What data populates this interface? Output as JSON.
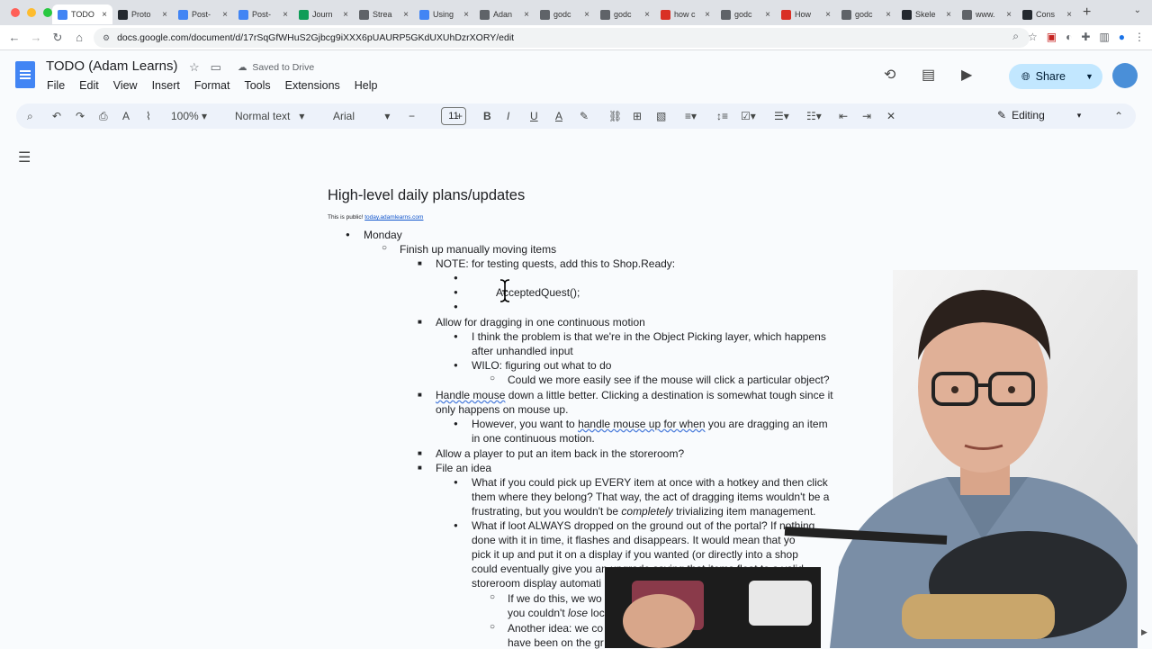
{
  "browser": {
    "tabs": [
      {
        "label": "TODO",
        "color": "#4285f4",
        "active": true
      },
      {
        "label": "Proto",
        "color": "#24292f"
      },
      {
        "label": "Post-",
        "color": "#4285f4"
      },
      {
        "label": "Post-",
        "color": "#4285f4"
      },
      {
        "label": "Journ",
        "color": "#0f9d58"
      },
      {
        "label": "Strea",
        "color": "#5f6368"
      },
      {
        "label": "Using",
        "color": "#4285f4"
      },
      {
        "label": "Adan",
        "color": "#5f6368"
      },
      {
        "label": "godc",
        "color": "#5f6368"
      },
      {
        "label": "godc",
        "color": "#5f6368"
      },
      {
        "label": "how c",
        "color": "#d93025"
      },
      {
        "label": "godc",
        "color": "#5f6368"
      },
      {
        "label": "How",
        "color": "#d93025"
      },
      {
        "label": "godc",
        "color": "#5f6368"
      },
      {
        "label": "Skele",
        "color": "#24292f"
      },
      {
        "label": "www.",
        "color": "#5f6368"
      },
      {
        "label": "Cons",
        "color": "#24292f"
      }
    ],
    "tab_close": "×",
    "new_tab": "+",
    "url": "docs.google.com/document/d/17rSqGfWHuS2Gjbcg9iXXX6pUAURP5GKdUXUhDzrXORY/edit"
  },
  "doc": {
    "title": "TODO (Adam Learns)",
    "saved_status": "Saved to Drive",
    "menus": [
      "File",
      "Edit",
      "View",
      "Insert",
      "Format",
      "Tools",
      "Extensions",
      "Help"
    ],
    "share_label": "Share",
    "toolbar": {
      "zoom": "100%",
      "style": "Normal text",
      "font": "Arial",
      "font_size": "11",
      "mode": "Editing"
    }
  },
  "content": {
    "heading": "High-level daily plans/updates",
    "public_note": "This is public!",
    "public_link": "today.adamlearns.com",
    "lines": [
      {
        "bullet": "●",
        "text": "Monday"
      },
      {
        "bullet": "○",
        "text": "Finish up manually moving items"
      },
      {
        "bullet": "■",
        "text": "NOTE: for testing quests, add this to Shop.Ready:"
      },
      {
        "bullet": "●",
        "text": ""
      },
      {
        "bullet": "●",
        "text": "AcceptedQuest();"
      },
      {
        "bullet": "●",
        "text": ""
      },
      {
        "bullet": "■",
        "text": "Allow for dragging in one continuous motion"
      },
      {
        "bullet": "●",
        "text": "I think the problem is that we're in the Object Picking layer, which happens"
      },
      {
        "bullet": "",
        "text": "after unhandled input"
      },
      {
        "bullet": "●",
        "text": "WILO: figuring out what to do"
      },
      {
        "bullet": "○",
        "text": "Could we more easily see if the mouse will click a particular object?"
      },
      {
        "bullet": "■",
        "text_pre": "Handle mouse",
        "text": " down a little better. Clicking a destination is somewhat tough since it"
      },
      {
        "bullet": "",
        "text": "only happens on mouse up."
      },
      {
        "bullet": "●",
        "text_pre": "However, you want to ",
        "text_mid": "handle mouse up for when",
        "text": " you are dragging an item"
      },
      {
        "bullet": "",
        "text": "in one continuous motion."
      },
      {
        "bullet": "■",
        "text": "Allow a player to put an item back in the storeroom?"
      },
      {
        "bullet": "■",
        "text": "File an idea"
      },
      {
        "bullet": "●",
        "text": "What if you could pick up EVERY item at once with a hotkey and then click"
      },
      {
        "bullet": "",
        "text": "them where they belong? That way, the act of dragging items wouldn't be a"
      },
      {
        "bullet": "",
        "text_pre": "frustrating, but you wouldn't be ",
        "text_em": "completely",
        "text": " trivializing item management."
      },
      {
        "bullet": "●",
        "text": "What if loot ALWAYS dropped on the ground out of the portal? If nothing"
      },
      {
        "bullet": "",
        "text": "done with it in time, it flashes and disappears. It would mean that yo"
      },
      {
        "bullet": "",
        "text": "pick it up and put it on a display if you wanted (or directly into a shop"
      },
      {
        "bullet": "",
        "text": "could eventually give you an upgrade saying that items float to a valid"
      },
      {
        "bullet": "",
        "text": "storeroom display automati"
      },
      {
        "bullet": "○",
        "text": "If we do this, we wo"
      },
      {
        "bullet": "",
        "text_pre": "you couldn't ",
        "text_em": "lose",
        "text": " loc"
      },
      {
        "bullet": "○",
        "text": "Another idea: we co"
      },
      {
        "bullet": "",
        "text": "have been on the gr"
      }
    ]
  },
  "colors": {
    "accent": "#1a73e8",
    "share_bg": "#c2e7ff",
    "toolbar_bg": "#edf2fa"
  }
}
